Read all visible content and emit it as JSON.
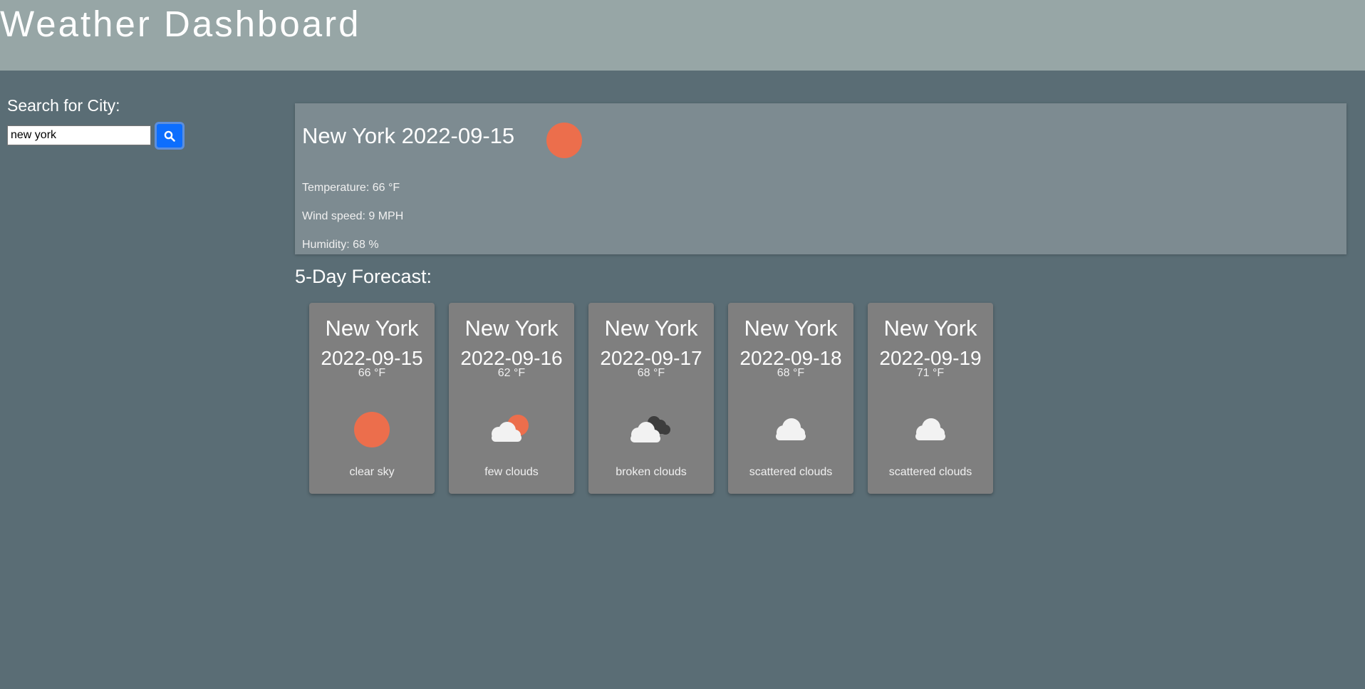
{
  "header": {
    "title": "Weather Dashboard"
  },
  "search": {
    "label": "Search for City:",
    "value": "new york",
    "button_icon": "search-icon"
  },
  "current": {
    "title": "New York 2022-09-15",
    "icon": "clear-sky-icon",
    "temperature": "Temperature: 66 °F",
    "wind": "Wind speed: 9 MPH",
    "humidity": "Humidity: 68 %"
  },
  "forecast": {
    "heading": "5-Day Forecast:",
    "days": [
      {
        "city": "New York",
        "date": "2022-09-15",
        "temp": "66 °F",
        "icon": "clear-sky-icon",
        "description": "clear sky"
      },
      {
        "city": "New York",
        "date": "2022-09-16",
        "temp": "62 °F",
        "icon": "few-clouds-icon",
        "description": "few clouds"
      },
      {
        "city": "New York",
        "date": "2022-09-17",
        "temp": "68 °F",
        "icon": "broken-clouds-icon",
        "description": "broken clouds"
      },
      {
        "city": "New York",
        "date": "2022-09-18",
        "temp": "68 °F",
        "icon": "scattered-clouds-icon",
        "description": "scattered clouds"
      },
      {
        "city": "New York",
        "date": "2022-09-19",
        "temp": "71 °F",
        "icon": "scattered-clouds-icon",
        "description": "scattered clouds"
      }
    ]
  },
  "colors": {
    "header_bg": "#97a6a6",
    "page_bg": "#5a6d75",
    "panel_bg": "#7d8b91",
    "card_bg": "#7f7f7f",
    "sun": "#ec6e4c",
    "button": "#0d6efd"
  }
}
